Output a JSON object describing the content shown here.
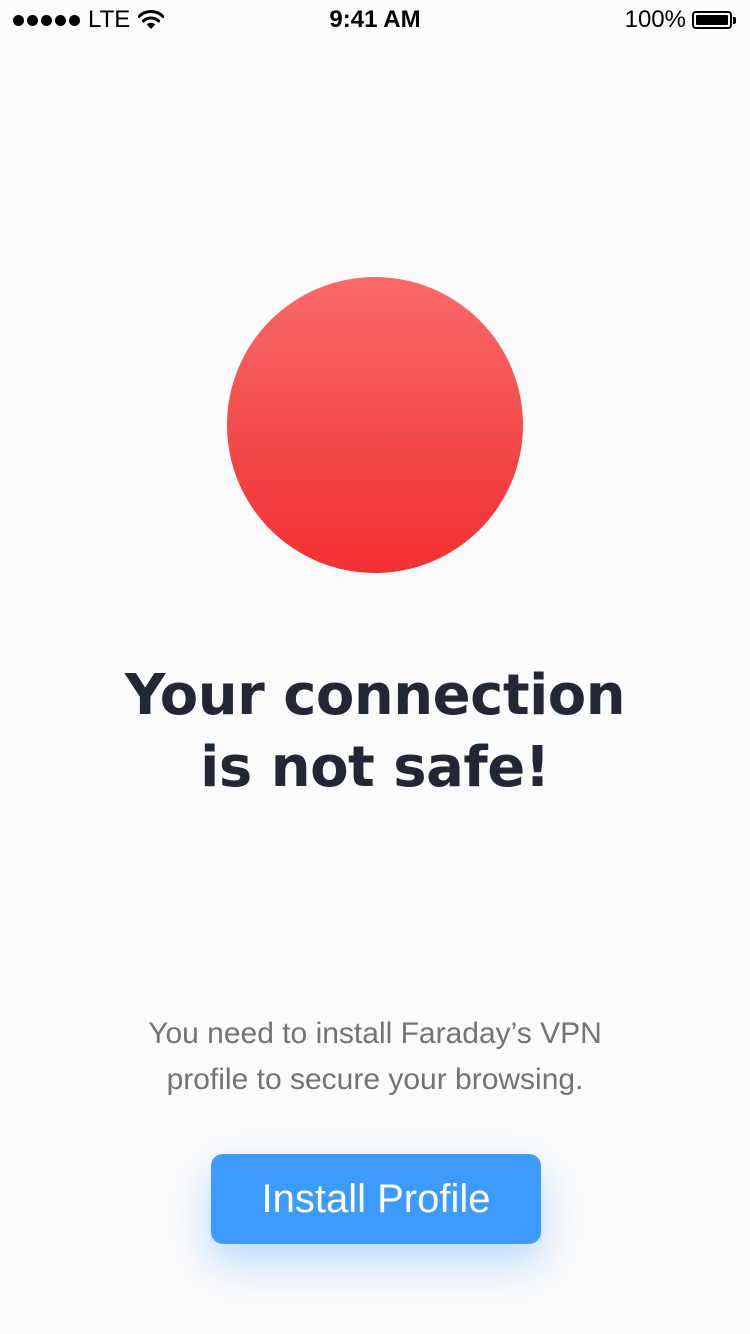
{
  "status_bar": {
    "carrier": "LTE",
    "time": "9:41 AM",
    "battery": "100%",
    "signal_icon": "cell-signal-icon",
    "wifi_icon": "wifi-icon",
    "battery_icon": "battery-icon"
  },
  "status_indicator": {
    "state": "unsafe",
    "color_top": "#fb6a6a",
    "color_bottom": "#f42f33"
  },
  "headline": {
    "line1": "Your connection",
    "line2": "is not safe!"
  },
  "description": {
    "line1": "You need to install Faraday’s VPN",
    "line2": "profile to secure your browsing."
  },
  "actions": {
    "install_label": "Install Profile",
    "accent_color": "#3d9bff"
  }
}
